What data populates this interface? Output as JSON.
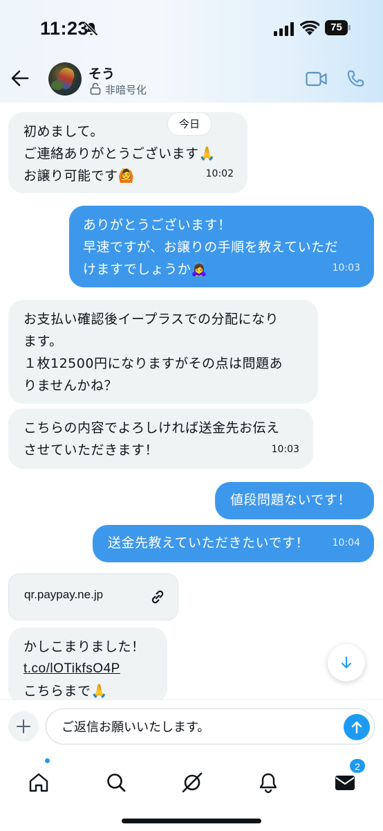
{
  "status": {
    "time": "11:23",
    "battery": "75"
  },
  "header": {
    "name": "そう",
    "encryption": "非暗号化"
  },
  "chat": {
    "day_chip": "今日",
    "messages": [
      {
        "dir": "in",
        "text": "初めまして。\nご連絡ありがとうございます🙏\nお譲り可能です🙆",
        "time": "10:02"
      },
      {
        "dir": "out",
        "text": "ありがとうございます！\n早速ですが、お譲りの手順を教えていただ\nけますでしょうか🙇‍♀️",
        "time": "10:03"
      },
      {
        "dir": "in",
        "text": "お支払い確認後イープラスでの分配になり\nます。\n１枚12500円になりますがその点は問題あ\nりませんかね？",
        "time": ""
      },
      {
        "dir": "in",
        "text": "こちらの内容でよろしければ送金先お伝え\nさせていただきます！",
        "time": "10:03"
      },
      {
        "dir": "out",
        "text": "値段問題ないです！",
        "time": ""
      },
      {
        "dir": "out",
        "text": "送金先教えていただきたいです！",
        "time": "10:04"
      }
    ],
    "link_card": {
      "domain": "qr.paypay.ne.jp"
    },
    "last_message": {
      "line1": "かしこまりました！",
      "link": "t.co/lOTikfsO4P",
      "line3": "こちらまで🙏"
    }
  },
  "composer": {
    "value": "ご返信お願いいたします。"
  },
  "tabs": [
    "home",
    "search",
    "grok",
    "notifications",
    "messages"
  ],
  "messages_badge": "2",
  "colors": {
    "accent": "#1d9bf0",
    "out_bubble": "#3d98ec",
    "in_bubble": "#eff3f4"
  }
}
